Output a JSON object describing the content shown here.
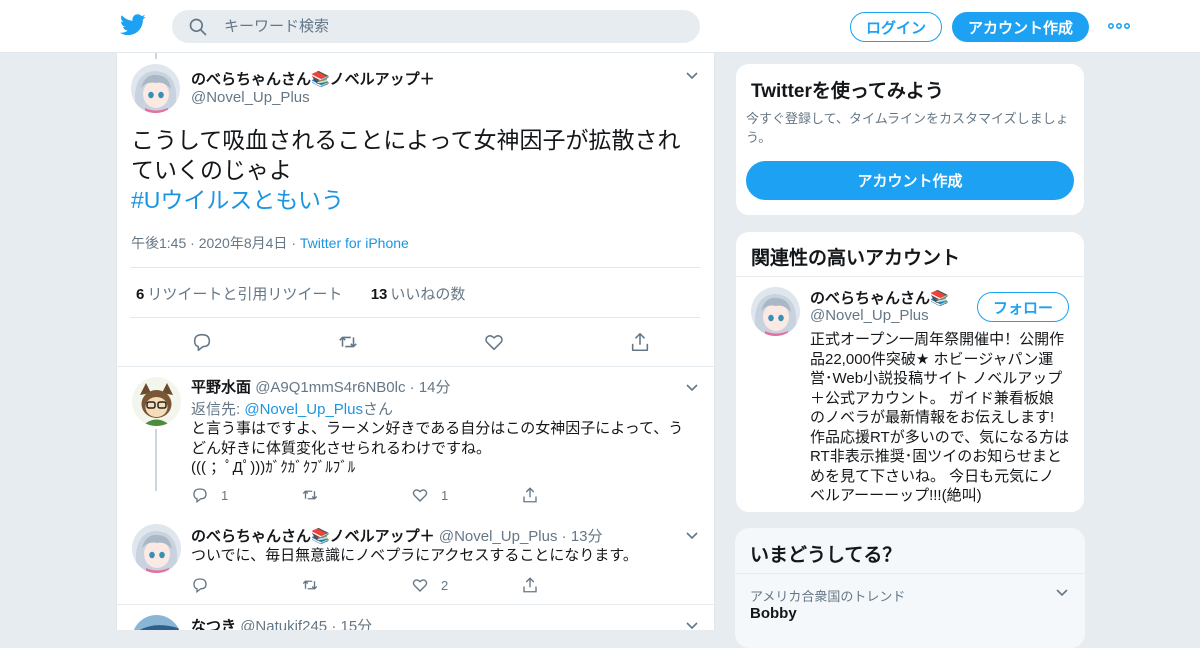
{
  "header": {
    "search_placeholder": "キーワード検索",
    "login_label": "ログイン",
    "signup_label": "アカウント作成"
  },
  "main_tweet": {
    "name": "のべらちゃんさん📚ノベルアップ＋",
    "handle": "@Novel_Up_Plus",
    "text_line1": "こうして吸血されることによって女神因子が拡散され",
    "text_line2": "ていくのじゃよ",
    "hashtag": "#Uウイルスともいう",
    "time": "午後1:45",
    "date": "2020年8月4日",
    "via": "Twitter for iPhone",
    "retweet_count": "6",
    "retweet_label": "リツイートと引用リツイート",
    "like_count": "13",
    "like_label": "いいねの数"
  },
  "replies": [
    {
      "name": "平野水面",
      "handle": "@A9Q1mmS4r6NB0lc",
      "age": "14分",
      "reply_to_prefix": "返信先: ",
      "reply_to_handle": "@Novel_Up_Plus",
      "reply_to_suffix": "さん",
      "text_line1": "と言う事はですよ、ラーメン好きである自分はこの女神因子によって、う",
      "text_line2": "どん好きに体質変化させられるわけですね。",
      "text_line3": "((( ；ﾟДﾟ)))ｶﾞｸｶﾞｸﾌﾞﾙﾌﾞﾙ",
      "reply_count": "1",
      "retweet_count": "",
      "like_count": "1"
    },
    {
      "name": "のべらちゃんさん📚ノベルアップ＋",
      "handle": "@Novel_Up_Plus",
      "age": "13分",
      "text_line1": "ついでに、毎日無意識にノベプラにアクセスすることになります。",
      "reply_count": "",
      "retweet_count": "",
      "like_count": "2"
    },
    {
      "name": "なつき",
      "handle": "@Natukif245",
      "age": "15分"
    }
  ],
  "sidebar": {
    "try_title": "Twitterを使ってみよう",
    "try_desc_line1": "今すぐ登録して、タイムラインをカスタマイズしましょ",
    "try_desc_line2": "う。",
    "try_cta": "アカウント作成",
    "related_title": "関連性の高いアカウント",
    "related_name": "のべらちゃんさん📚",
    "related_handle": "@Novel_Up_Plus",
    "follow_label": "フォロー",
    "bio_lines": [
      "正式オープン一周年祭開催中！公開作",
      "品22,000件突破★ ホビージャパン運",
      "営･Web小説投稿サイト ノベルアップ",
      "＋公式アカウント。 ガイド兼看板娘",
      "のノベラが最新情報をお伝えします!",
      "作品応援RTが多いので、気になる方は",
      "RT非表示推奨･固ツイのお知らせまと",
      "めを見て下さいね。 今日も元気にノ",
      "ベルアーーーップ!!!(絶叫)"
    ],
    "trends_title": "いまどうしてる？",
    "trend_location": "アメリカ合衆国のトレンド",
    "trend_name": "Bobby"
  },
  "colors": {
    "accent": "#1da1f2",
    "link": "#1b95e0",
    "muted": "#657786",
    "background": "#e6ecf0"
  }
}
